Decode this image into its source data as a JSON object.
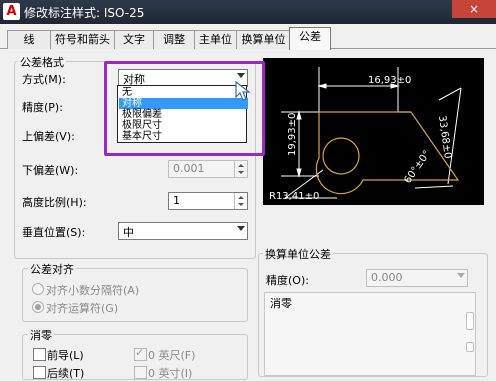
{
  "window": {
    "app_icon": "A",
    "title": "修改标注样式: ISO-25",
    "close_label": "×"
  },
  "tabs": [
    {
      "label": "线",
      "active": false
    },
    {
      "label": "符号和箭头",
      "active": false
    },
    {
      "label": "文字",
      "active": false
    },
    {
      "label": "调整",
      "active": false
    },
    {
      "label": "主单位",
      "active": false
    },
    {
      "label": "换算单位",
      "active": false
    },
    {
      "label": "公差",
      "active": true
    }
  ],
  "tolerance_format": {
    "group_title": "公差格式",
    "method_label": "方式(M):",
    "method_value": "对称",
    "method_options": [
      "无",
      "对称",
      "极限偏差",
      "极限尺寸",
      "基本尺寸"
    ],
    "precision_label": "精度(P):",
    "upper_label": "上偏差(V):",
    "lower_label": "下偏差(W):",
    "lower_value": "0.001",
    "height_label": "高度比例(H):",
    "height_value": "1",
    "vpos_label": "垂直位置(S):",
    "vpos_value": "中"
  },
  "tolerance_align": {
    "group_title": "公差对齐",
    "option1": "对齐小数分隔符(A)",
    "option2": "对齐运算符(G)"
  },
  "zero_suppress": {
    "group_title": "消零",
    "leading_label": "前导(L)",
    "feet_label": "0 英尺(F)",
    "trailing_label": "后续(T)",
    "inches_label": "0 英寸(I)"
  },
  "alt_unit_tolerance": {
    "group_title": "换算单位公差",
    "precision_label": "精度(O):",
    "precision_value": "0.000",
    "zero_group_title": "消零"
  },
  "preview": {
    "dim_top": "16,93±0",
    "dim_left": "19,93±0",
    "dim_right": "33,68±0",
    "dim_angle": "60°±0°",
    "dim_radius": "R13,41±0"
  },
  "colors": {
    "highlight": "#9b27c4",
    "preview_bg": "#000000",
    "preview_geom": "#d9a441",
    "preview_dim": "#ffffff",
    "selection": "#3399ff"
  }
}
